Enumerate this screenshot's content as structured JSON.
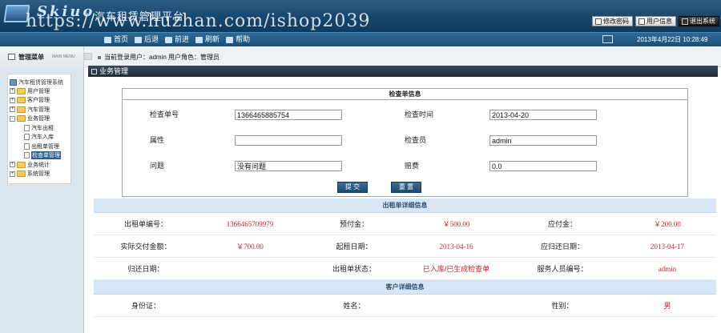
{
  "header": {
    "brand": "Skiuo",
    "app_title": "汽车租赁管理平台",
    "watermark": "https://www.huzhan.com/ishop2039",
    "actions": [
      "修改密码",
      "用户信息",
      "退出系统"
    ]
  },
  "nav": {
    "items": [
      "首页",
      "后退",
      "前进",
      "刷新",
      "帮助"
    ],
    "datetime": "2013年4月22日  10:28:49"
  },
  "subbar": {
    "menu_title": "管理菜单",
    "menu_title_en": "MAIN MENU",
    "login_info": "当前登录用户：admin 用户角色：管理员"
  },
  "sidebar": {
    "root": "汽车租赁管理系统",
    "items": [
      {
        "label": "用户管理",
        "type": "folder",
        "sign": "+"
      },
      {
        "label": "客户管理",
        "type": "folder",
        "sign": "+"
      },
      {
        "label": "汽车管理",
        "type": "folder",
        "sign": "+"
      },
      {
        "label": "业务管理",
        "type": "folder",
        "sign": "-"
      },
      {
        "label": "汽车出租",
        "type": "doc"
      },
      {
        "label": "汽车入库",
        "type": "doc"
      },
      {
        "label": "出租单管理",
        "type": "doc"
      },
      {
        "label": "检查单管理",
        "type": "doc",
        "selected": true
      },
      {
        "label": "业务统计",
        "type": "folder",
        "sign": "+"
      },
      {
        "label": "系统管理",
        "type": "folder",
        "sign": "+"
      }
    ]
  },
  "main": {
    "section_title": "业务管理",
    "check_form": {
      "caption": "检查单信息",
      "fields": {
        "check_no": {
          "label": "检查单号",
          "value": "1366465885754"
        },
        "check_time": {
          "label": "检查时间",
          "value": "2013-04-20"
        },
        "attribute": {
          "label": "属性",
          "value": ""
        },
        "inspector": {
          "label": "检查员",
          "value": "admin"
        },
        "problem": {
          "label": "问题",
          "value": "没有问题"
        },
        "compensation": {
          "label": "赔费",
          "value": "0.0"
        }
      },
      "submit_label": "提 交",
      "reset_label": "重 置"
    },
    "rental_detail": {
      "title": "出租单详细信息",
      "rows": [
        [
          "出租单编号：",
          "1366465709979",
          "预付金：",
          "￥500.00",
          "应付金：",
          "￥200.00"
        ],
        [
          "实际交付金额：",
          "￥700.00",
          "起租日期：",
          "2013-04-16",
          "应归还日期：",
          "2013-04-17"
        ],
        [
          "归还日期：",
          "",
          "出租单状态：",
          "已入库/已生成检查单",
          "服务人员编号：",
          "admin"
        ]
      ]
    },
    "customer_detail": {
      "title": "客户详细信息",
      "rows": [
        [
          "身份证：",
          "",
          "姓名：",
          "",
          "性别：",
          "男"
        ]
      ]
    }
  }
}
